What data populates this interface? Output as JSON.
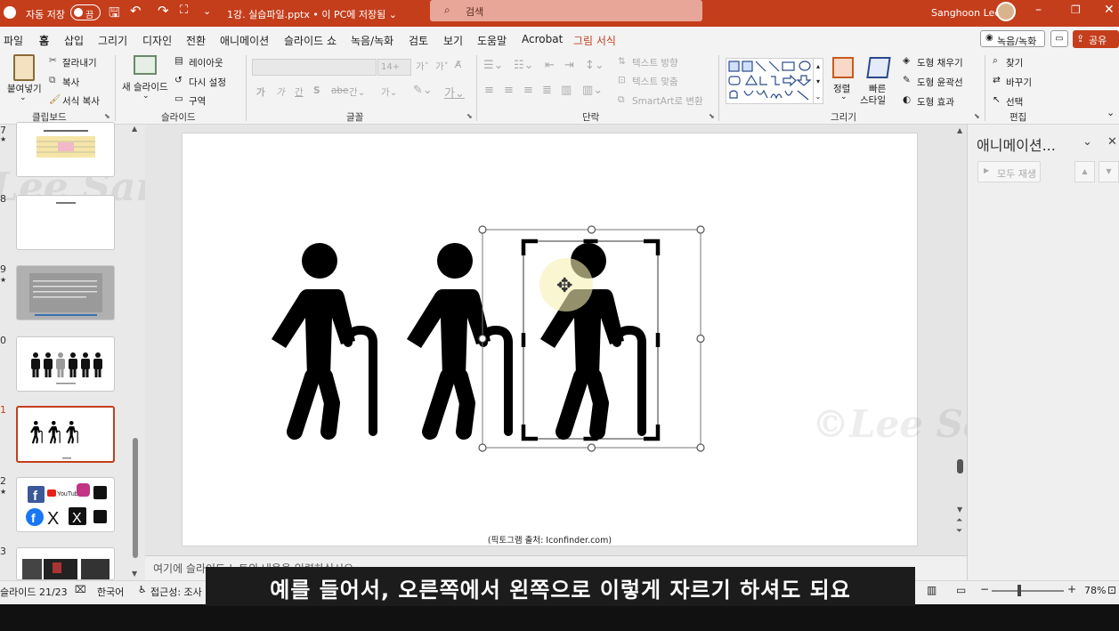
{
  "titlebar": {
    "autosave_label": "자동 저장",
    "autosave_state": "끔",
    "doc_title": "1강. 실습파일.pptx • 이 PC에 저장됨 ⌄",
    "search_placeholder": "검색",
    "user_name": "Sanghoon Lee"
  },
  "menu": {
    "items": [
      "파일",
      "홈",
      "삽입",
      "그리기",
      "디자인",
      "전환",
      "애니메이션",
      "슬라이드 쇼",
      "녹음/녹화",
      "검토",
      "보기",
      "도움말",
      "Acrobat",
      "그림 서식"
    ],
    "record_button": "녹음/녹화",
    "share_button": "공유"
  },
  "ribbon": {
    "clipboard": {
      "paste": "붙여넣기",
      "cut": "잘라내기",
      "copy": "복사",
      "format_painter": "서식 복사",
      "group": "클립보드"
    },
    "slides": {
      "new_slide": "새 슬라이드",
      "layout": "레이아웃",
      "reset": "다시 설정",
      "section": "구역",
      "group": "슬라이드"
    },
    "font": {
      "size": "14+",
      "group": "글꼴"
    },
    "paragraph": {
      "text_direction": "텍스트 방향",
      "align_text": "텍스트 맞춤",
      "smartart": "SmartArt로 변환",
      "group": "단락"
    },
    "drawing": {
      "arrange": "정렬",
      "quick_styles_1": "빠른",
      "quick_styles_2": "스타일",
      "shape_fill": "도형 채우기",
      "shape_outline": "도형 윤곽선",
      "shape_effects": "도형 효과",
      "group": "그리기"
    },
    "editing": {
      "find": "찾기",
      "replace": "바꾸기",
      "select": "선택",
      "group": "편집"
    }
  },
  "thumbnails": [
    {
      "num": "7",
      "star": "★"
    },
    {
      "num": "8",
      "star": ""
    },
    {
      "num": "9",
      "star": "★"
    },
    {
      "num": "0",
      "star": ""
    },
    {
      "num": "1",
      "star": ""
    },
    {
      "num": "2",
      "star": "★"
    },
    {
      "num": "3",
      "star": ""
    }
  ],
  "slide": {
    "caption": "(픽토그램 출처: Iconfinder.com)",
    "watermark_left": "Lee Sanghoon",
    "watermark_right": "©Lee Sangho"
  },
  "notes_placeholder": "여기에 슬라이드 노트의 내용을 입력하십시오",
  "animation_pane": {
    "title": "애니메이션...",
    "play_all": "모두 재생"
  },
  "status": {
    "slide_info": "슬라이드 21/23",
    "language": "한국어",
    "accessibility": "접근성: 조사 필요",
    "zoom": "78%"
  },
  "subtitle": "예를 들어서, 오른쪽에서 왼쪽으로 이렇게 자르기 하셔도 되요",
  "colors": {
    "accent": "#c43e1c"
  }
}
